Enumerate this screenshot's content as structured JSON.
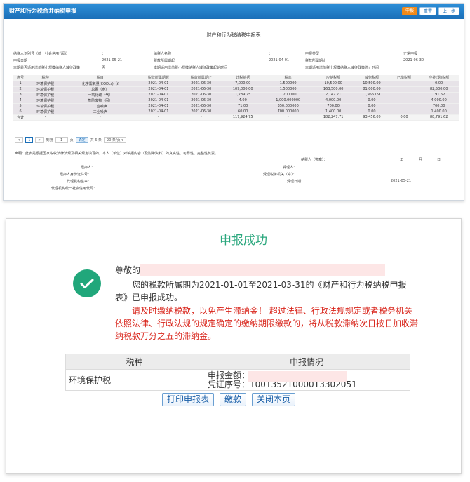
{
  "top": {
    "title": "财产和行为税合并纳税申报",
    "buttons": {
      "submit": "申报",
      "reset": "重置",
      "prev": "上一步"
    },
    "form_title": "财产和行为税纳税申报表",
    "info": {
      "taxpayer_id_label": "纳税人识别号（统一社会信用代码）",
      "taxpayer_id_value": "：",
      "taxpayer_name_label": "纳税人名称",
      "taxpayer_name_value": "：",
      "decl_type_label": "申报类型",
      "decl_type_value": "正常申报",
      "date_label": "申报日期",
      "date_value": "2021-05-21",
      "period_start_label": "税款所属期起",
      "period_start_value": "2021-04-01",
      "period_end_label": "税款所属期止",
      "period_end_value": "2021-06-30",
      "small_flag_label": "本期是否适用增值税小规模纳税人减征政策",
      "small_flag_value": "否",
      "small_start_label": "本期适用增值税小规模纳税人减征政策起始时间",
      "small_end_label": "本期适用增值税小规模纳税人减征政策终止时间"
    },
    "table": {
      "headers": [
        "序号",
        "税种",
        "税目",
        "税款所属期起",
        "税款所属期止",
        "计税依据",
        "税率",
        "应纳税额",
        "减免税额",
        "已缴税额",
        "应补(退)税额"
      ],
      "rows": [
        [
          "1",
          "环境保护税",
          "化学需氧量(CODcr)（ℓ",
          "2021-04-01",
          "2021-06-30",
          "7,000.00",
          "1.500000",
          "10,500.00",
          "10,500.00",
          "",
          "0.00"
        ],
        [
          "2",
          "环境保护税",
          "总汞（水）",
          "2021-04-01",
          "2021-06-30",
          "109,000.00",
          "1.500000",
          "163,500.00",
          "81,000.00",
          "",
          "82,500.00"
        ],
        [
          "3",
          "环境保护税",
          "一氧化碳（气）",
          "2021-04-01",
          "2021-06-30",
          "1,789.75",
          "1.200000",
          "2,147.71",
          "1,956.09",
          "",
          "191.62"
        ],
        [
          "4",
          "环境保护税",
          "危险废物（固）",
          "2021-04-01",
          "2021-06-30",
          "4.00",
          "1,000.000000",
          "4,000.00",
          "0.00",
          "",
          "4,000.00"
        ],
        [
          "5",
          "环境保护税",
          "工业噪声",
          "2021-04-01",
          "2021-06-30",
          "71.00",
          "350.000000",
          "700.00",
          "0.00",
          "",
          "700.00"
        ],
        [
          "6",
          "环境保护税",
          "工业噪声",
          "2021-04-01",
          "2021-06-30",
          "60.00",
          "700.000000",
          "1,400.00",
          "0.00",
          "",
          "1,400.00"
        ]
      ],
      "total": [
        "合计",
        "-",
        "-",
        "-",
        "-",
        "117,924.75",
        "-",
        "182,247.71",
        "93,456.09",
        "0.00",
        "88,791.62"
      ]
    },
    "pager": {
      "prev": "<",
      "page": "1",
      "next": ">",
      "goto": "到第",
      "page_input": "1",
      "page_unit": "页",
      "confirm": "确定",
      "count": "共 6 条",
      "page_size": "20 条/页 ▾"
    },
    "declaration": "声明：此表是根据国家税收法律法规及相关规定填写的，本人（单位）对填报内容（及附带资料）的真实性、可靠性、完整性负责。",
    "sign": {
      "taxpayer_seal": "纳税人（签章）：",
      "year": "年",
      "month": "月",
      "day": "日",
      "handler": "经办人：",
      "handler_id": "经办人身份证件号：",
      "agent": "代理机构签章：",
      "agent_code": "代理机构统一社会信用代码：",
      "receiver": "受理人：",
      "receiver_org": "受理税务机关（章）：",
      "receive_date": "受理日期：",
      "receive_date_value": "2021-05-21"
    }
  },
  "dialog": {
    "title": "申报成功",
    "greeting": "尊敬的",
    "message": "您的税款所属期为2021-01-01至2021-03-31的《财产和行为税纳税申报表》已申报成功。",
    "warning": "请及时缴纳税款，以免产生滞纳金！ 超过法律、行政法规规定或者税务机关依照法律、行政法规的规定确定的缴纳期限缴款的，将从税款滞纳次日按日加收滞纳税款万分之五的滞纳金。",
    "table_headers": [
      "税种",
      "申报情况"
    ],
    "tax_type": "环境保护税",
    "amount_label": "申报金额：",
    "voucher_label": "凭证序号：",
    "voucher_value": "10013521000013302051",
    "buttons": {
      "print": "打印申报表",
      "pay": "缴款",
      "close": "关闭本页"
    },
    "colors": {
      "success": "#21a77b",
      "warning": "#d9261c",
      "link": "#1a5fa8"
    }
  }
}
